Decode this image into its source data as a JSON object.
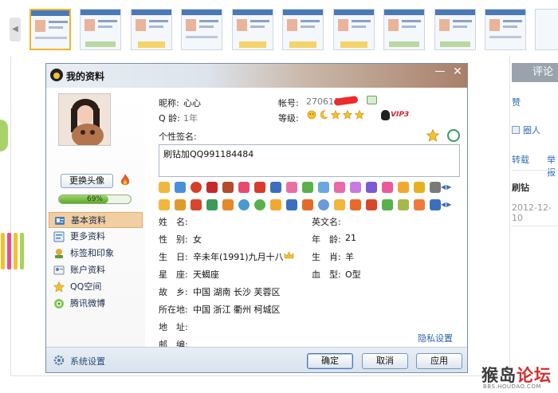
{
  "window": {
    "title": "我的资料",
    "minimize_glyph": "—",
    "close_glyph": "✕"
  },
  "strip": {
    "prev_glyph": "◀",
    "thumbnail_count": 10,
    "selected_index": 0
  },
  "comments": {
    "tab_label": "评论",
    "items": [
      {
        "text": "赞"
      },
      {
        "text": "圈人"
      },
      {
        "text": "转载"
      },
      {
        "text": "举报"
      }
    ],
    "author": "刷钻",
    "date": "2012-12-10"
  },
  "watermark": {
    "title_main": "猴岛",
    "title_accent": "论坛",
    "url": "BBS.HOUDAO.COM"
  },
  "profile": {
    "nickname_label": "昵称:",
    "nickname": "心心",
    "qage_label": "Q 龄:",
    "qage": "1年",
    "account_label": "帐号:",
    "account": "270611",
    "level_label": "等级:",
    "level_icons": [
      "sun-icon",
      "moon-icon",
      "star-icon",
      "star-icon",
      "star-icon"
    ],
    "vip_badge": "VIP3",
    "signature_label": "个性签名:",
    "signature": "刷钻加QQ991184484",
    "completion_percent": 69,
    "completion_text": "69%",
    "change_avatar_label": "更换头像"
  },
  "nav": [
    {
      "label": "基本资料",
      "icon": "id-card-icon",
      "active": true
    },
    {
      "label": "更多资料",
      "icon": "profile-card-icon",
      "active": false
    },
    {
      "label": "标签和印象",
      "icon": "tag-icon",
      "active": false
    },
    {
      "label": "账户资料",
      "icon": "account-icon",
      "active": false
    },
    {
      "label": "QQ空间",
      "icon": "star-space-icon",
      "active": false
    },
    {
      "label": "腾讯微博",
      "icon": "weibo-icon",
      "active": false
    }
  ],
  "details": {
    "name_label": "姓　名:",
    "name_value": "",
    "gender_label": "性　别:",
    "gender_value": "女",
    "birthday_label": "生　日:",
    "birthday_value": "辛未年(1991)九月十八",
    "constellation_label": "星　座:",
    "constellation_value": "天蝎座",
    "hometown_label": "故　乡:",
    "hometown_value": "中国  湖南  长沙  芙蓉区",
    "location_label": "所在地:",
    "location_value": "中国  浙江  衢州  柯城区",
    "address_label": "地　址:",
    "address_value": "",
    "postcode_label": "邮　编:",
    "postcode_value": "",
    "english_name_label": "英文名:",
    "english_name_value": "",
    "age_label": "年　龄:",
    "age_value": "21",
    "zodiac_label": "生　肖:",
    "zodiac_value": "羊",
    "blood_label": "血　型:",
    "blood_value": "O型"
  },
  "privacy_link": "隐私设置",
  "bottom": {
    "settings_label": "系统设置",
    "ok_label": "确定",
    "cancel_label": "取消",
    "apply_label": "应用"
  },
  "nav_arrows": "▲▼",
  "row_arrows": "◀▶",
  "colors": {
    "accent_blue": "#2a62b0",
    "nav_active": "#f1cfa2",
    "progress_green": "#5aa92a",
    "watermark_red": "#d12f2f"
  }
}
